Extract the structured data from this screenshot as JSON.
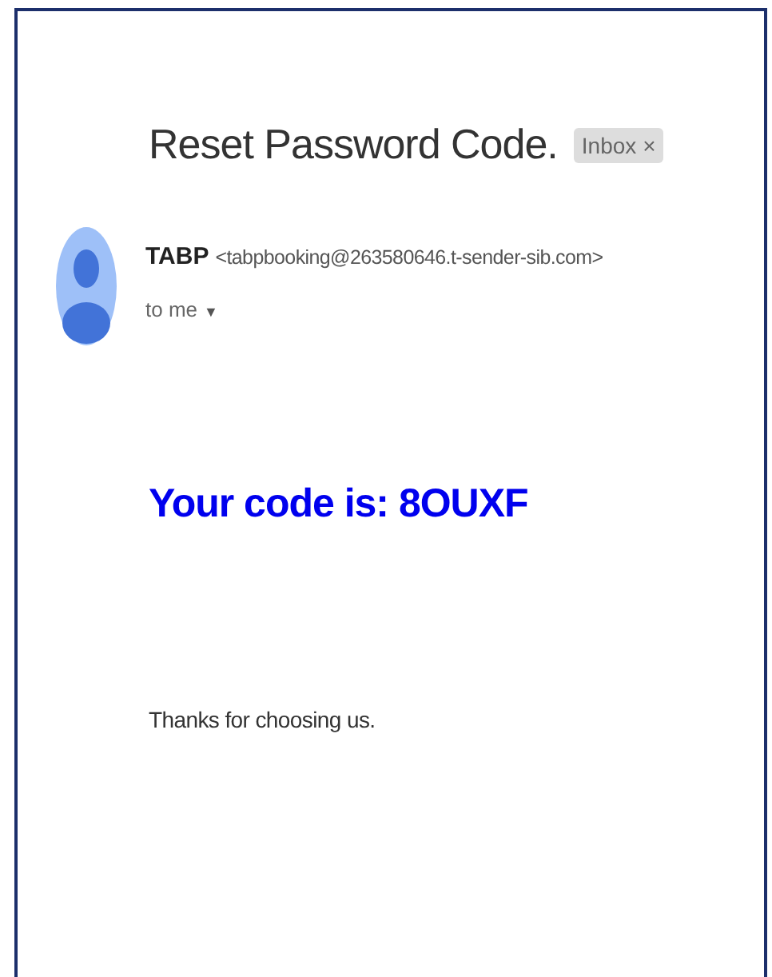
{
  "email": {
    "subject": "Reset Password Code.",
    "label": {
      "text": "Inbox",
      "close": "×"
    },
    "sender": {
      "name": "TABP",
      "address": "<tabpbooking@263580646.t-sender-sib.com>"
    },
    "recipient": {
      "text": "to me",
      "caret": "▼"
    },
    "code_line": "Your code is: 8OUXF",
    "closing": "Thanks for choosing us."
  }
}
